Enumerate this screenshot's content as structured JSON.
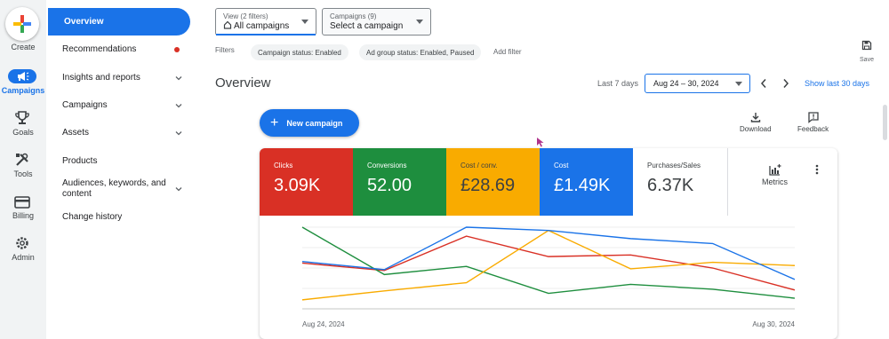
{
  "rail": {
    "create": "Create",
    "items": [
      {
        "label": "Campaigns",
        "icon": "megaphone-icon",
        "active": true
      },
      {
        "label": "Goals",
        "icon": "trophy-icon"
      },
      {
        "label": "Tools",
        "icon": "tools-icon"
      },
      {
        "label": "Billing",
        "icon": "credit-card-icon"
      },
      {
        "label": "Admin",
        "icon": "gear-icon"
      }
    ]
  },
  "nav": {
    "items": [
      {
        "label": "Overview",
        "active": true
      },
      {
        "label": "Recommendations",
        "badge": "red-dot"
      },
      {
        "label": "Insights and reports",
        "expandable": true
      },
      {
        "label": "Campaigns",
        "expandable": true
      },
      {
        "label": "Assets",
        "expandable": true
      },
      {
        "label": "Products"
      },
      {
        "label": "Audiences, keywords, and content",
        "expandable": true
      },
      {
        "label": "Change history"
      }
    ]
  },
  "header": {
    "view_filter": {
      "small": "View (2 filters)",
      "value": "All campaigns"
    },
    "campaign_filter": {
      "small": "Campaigns (9)",
      "value": "Select a campaign"
    },
    "filters_label": "Filters",
    "chips": [
      "Campaign status: Enabled",
      "Ad group status: Enabled, Paused"
    ],
    "add_filter": "Add filter",
    "save": "Save"
  },
  "overview": {
    "title": "Overview",
    "range_label": "Last 7 days",
    "date_range": "Aug 24 – 30, 2024",
    "show_30": "Show last 30 days",
    "new_campaign": "New campaign",
    "download": "Download",
    "feedback": "Feedback"
  },
  "metrics": {
    "tiles": [
      {
        "label": "Clicks",
        "value": "3.09K",
        "color": "#d93025"
      },
      {
        "label": "Conversions",
        "value": "52.00",
        "color": "#1e8e3e"
      },
      {
        "label": "Cost / conv.",
        "value": "£28.69",
        "color": "#f9ab00"
      },
      {
        "label": "Cost",
        "value": "£1.49K",
        "color": "#1a73e8"
      },
      {
        "label": "Purchases/Sales",
        "value": "6.37K",
        "color": "#ffffff"
      }
    ],
    "metrics_button": "Metrics"
  },
  "chart_data": {
    "type": "line",
    "x": [
      "Aug 24, 2024",
      "Aug 25, 2024",
      "Aug 26, 2024",
      "Aug 27, 2024",
      "Aug 28, 2024",
      "Aug 29, 2024",
      "Aug 30, 2024"
    ],
    "x_tick_labels": [
      "Aug 24, 2024",
      "Aug 30, 2024"
    ],
    "ylim": [
      0,
      100
    ],
    "grid": true,
    "series": [
      {
        "color": "#d93025",
        "values": [
          56,
          47,
          89,
          64,
          66,
          50,
          23
        ]
      },
      {
        "color": "#1e8e3e",
        "values": [
          100,
          42,
          52,
          19,
          30,
          24,
          13
        ]
      },
      {
        "color": "#f9ab00",
        "values": [
          11,
          22,
          32,
          96,
          49,
          57,
          53
        ]
      },
      {
        "color": "#1a73e8",
        "values": [
          58,
          48,
          100,
          96,
          86,
          80,
          36
        ]
      }
    ]
  }
}
